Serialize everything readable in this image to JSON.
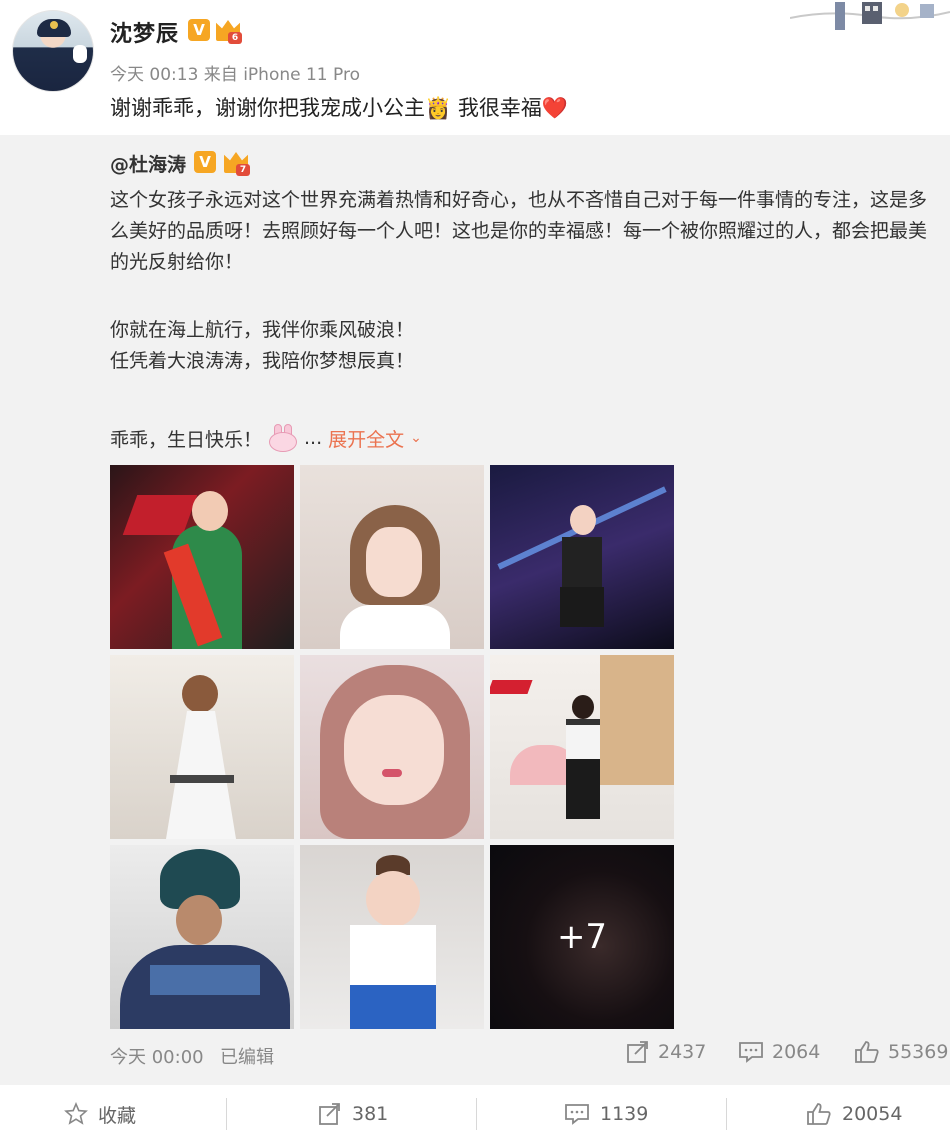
{
  "post": {
    "author": "沈梦辰",
    "vip_badge": "V",
    "crown_level": "6",
    "meta": "今天 00:13 来自 iPhone 11 Pro",
    "text": "谢谢乖乖，谢谢你把我宠成小公主👸 我很幸福❤️"
  },
  "repost": {
    "author": "@杜海涛",
    "vip_badge": "V",
    "crown_level": "7",
    "paragraph1": "这个女孩子永远对这个世界充满着热情和好奇心，也从不吝惜自己对于每一件事情的专注，这是多么美好的品质呀！去照顾好每一个人吧！这也是你的幸福感！每一个被你照耀过的人，都会把最美的光反射给你！",
    "line2": "你就在海上航行，我伴你乘风破浪！",
    "line3": "任凭着大浪涛涛，我陪你梦想辰真！",
    "last_line": "乖乖，生日快乐！",
    "ellipsis": "...",
    "expand_label": "展开全文",
    "more_count": "+7",
    "time": "今天 00:00",
    "edited": "已编辑",
    "stats": {
      "repost": "2437",
      "comment": "2064",
      "like": "55369"
    }
  },
  "actions": {
    "favorite": "收藏",
    "repost": "381",
    "comment": "1139",
    "like": "20054"
  },
  "colors": {
    "link": "#eb7350",
    "vip": "#f6a623",
    "bg_repost": "#f2f2f2"
  }
}
